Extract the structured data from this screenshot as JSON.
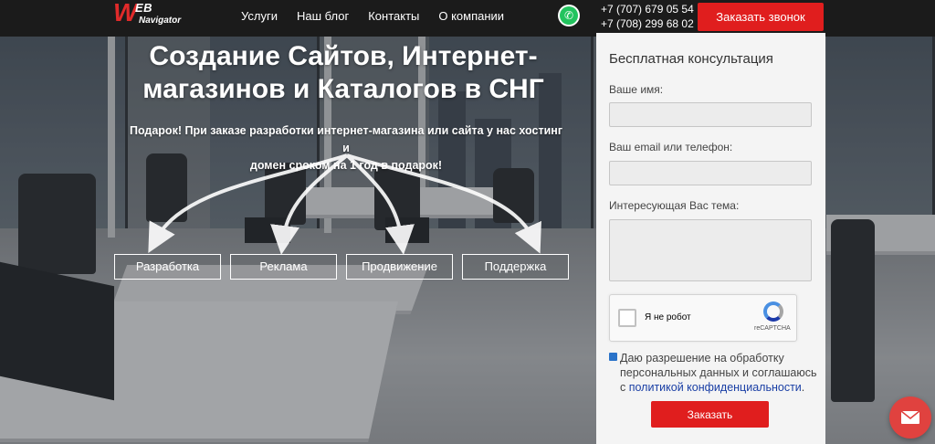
{
  "header": {
    "logo": {
      "w": "W",
      "eb": "EB",
      "sub": "Navigator"
    },
    "nav": [
      "Услуги",
      "Наш блог",
      "Контакты",
      "О компании"
    ],
    "phones": [
      "+7 (707) 679 05 54",
      "+7 (708) 299 68 02"
    ],
    "call_button": "Заказать звонок",
    "whatsapp_icon": "whatsapp-icon"
  },
  "hero": {
    "title_line1": "Создание Сайтов, Интернет-",
    "title_line2": "магазинов и Каталогов в СНГ",
    "subtitle_line1": "Подарок! При заказе разработки интернет-магазина или сайта у нас хостинг и",
    "subtitle_line2": "домен сроком на 1 год в подарок!",
    "services": [
      "Разработка",
      "Реклама",
      "Продвижение",
      "Поддержка"
    ]
  },
  "form": {
    "title": "Бесплатная консультация",
    "name_label": "Ваше имя:",
    "contact_label": "Ваш email или телефон:",
    "topic_label": "Интересующая Вас тема:",
    "captcha_text": "Я не робот",
    "captcha_brand": "reCAPTCHA",
    "consent_text": "Даю разрешение на обработку персональных данных и соглашаюсь с",
    "consent_link": "политикой конфиденциальности",
    "consent_end": ".",
    "submit_label": "Заказать",
    "consent_checked": true
  },
  "colors": {
    "accent": "#e01e1e",
    "link": "#1a3fa5",
    "header_bg": "#1b1b1b"
  },
  "fab": {
    "icon": "mail-icon"
  }
}
